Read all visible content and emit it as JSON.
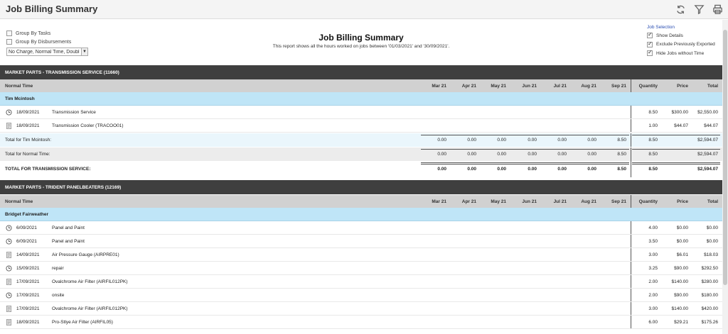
{
  "app": {
    "title": "Job Billing Summary"
  },
  "options": {
    "group_by_tasks": "Group By Tasks",
    "group_by_disbursements": "Group By Disbursements",
    "rate_filter": "No Charge, Normal Time, Doubl"
  },
  "heading": {
    "title": "Job Billing Summary",
    "subtitle": "This report shows all the hours worked on jobs between '01/03/2021' and '30/09/2021'."
  },
  "job_selection": {
    "label": "Job Selection",
    "show_details": "Show Details",
    "exclude_exported": "Exclude Previously Exported",
    "hide_no_time": "Hide Jobs without Time"
  },
  "columns": {
    "months": [
      "Mar 21",
      "Apr 21",
      "May 21",
      "Jun 21",
      "Jul 21",
      "Aug 21",
      "Sep 21"
    ],
    "quantity": "Quantity",
    "price": "Price",
    "total": "Total"
  },
  "jobs": [
    {
      "title": "MARKET PARTS - TRANSMISSION SERVICE (11660)",
      "rate": "Normal Time",
      "person": "Tim Mcintosh",
      "lines": [
        {
          "icon": "clock-icon",
          "date": "18/09/2021",
          "desc": "Transmission Service",
          "qty": "8.50",
          "price": "$300.00",
          "total": "$2,550.00"
        },
        {
          "icon": "document-icon",
          "date": "18/09/2021",
          "desc": "Transmission Cooler (TRACOO01)",
          "qty": "1.00",
          "price": "$44.07",
          "total": "$44.07"
        }
      ],
      "person_total": {
        "label": "Total for Tim Mcintosh:",
        "months": [
          "0.00",
          "0.00",
          "0.00",
          "0.00",
          "0.00",
          "0.00",
          "8.50"
        ],
        "qty": "8.50",
        "total": "$2,594.07"
      },
      "rate_total": {
        "label": "Total for Normal Time:",
        "months": [
          "0.00",
          "0.00",
          "0.00",
          "0.00",
          "0.00",
          "0.00",
          "8.50"
        ],
        "qty": "8.50",
        "total": "$2,594.07"
      },
      "grand_total": {
        "label": "TOTAL FOR TRANSMISSION SERVICE:",
        "months": [
          "0.00",
          "0.00",
          "0.00",
          "0.00",
          "0.00",
          "0.00",
          "8.50"
        ],
        "qty": "8.50",
        "total": "$2,594.07"
      }
    },
    {
      "title": "MARKET PARTS - TRIDENT PANELBEATERS (12169)",
      "rate": "Normal Time",
      "person": "Bridget Fairweather",
      "lines": [
        {
          "icon": "clock-icon",
          "date": "6/09/2021",
          "desc": "Panel and Paint",
          "qty": "4.00",
          "price": "$0.00",
          "total": "$0.00"
        },
        {
          "icon": "clock-icon",
          "date": "6/09/2021",
          "desc": "Panel and Paint",
          "qty": "3.50",
          "price": "$0.00",
          "total": "$0.00"
        },
        {
          "icon": "document-icon",
          "date": "14/09/2021",
          "desc": "Air Pressure Gauge (AIRPRE01)",
          "qty": "3.00",
          "price": "$6.01",
          "total": "$18.03"
        },
        {
          "icon": "clock-icon",
          "date": "15/09/2021",
          "desc": "repair",
          "qty": "3.25",
          "price": "$90.00",
          "total": "$292.50"
        },
        {
          "icon": "document-icon",
          "date": "17/09/2021",
          "desc": "Ovalchrome Air Filter (AIRFIL012PK)",
          "qty": "2.00",
          "price": "$140.00",
          "total": "$280.00"
        },
        {
          "icon": "clock-icon",
          "date": "17/09/2021",
          "desc": "onsite",
          "qty": "2.00",
          "price": "$90.00",
          "total": "$180.00"
        },
        {
          "icon": "document-icon",
          "date": "17/09/2021",
          "desc": "Ovalchrome Air Filter (AIRFIL012PK)",
          "qty": "3.00",
          "price": "$140.00",
          "total": "$420.00"
        },
        {
          "icon": "document-icon",
          "date": "18/09/2021",
          "desc": "Pro-Stlye Air Filter (AIRFIL05)",
          "qty": "6.00",
          "price": "$29.21",
          "total": "$175.26"
        }
      ]
    }
  ],
  "colors": {
    "job_header": "#3f3f3f",
    "column_header": "#d1d1d1",
    "person_row": "#bfe5f7",
    "link": "#2b4fb3"
  }
}
